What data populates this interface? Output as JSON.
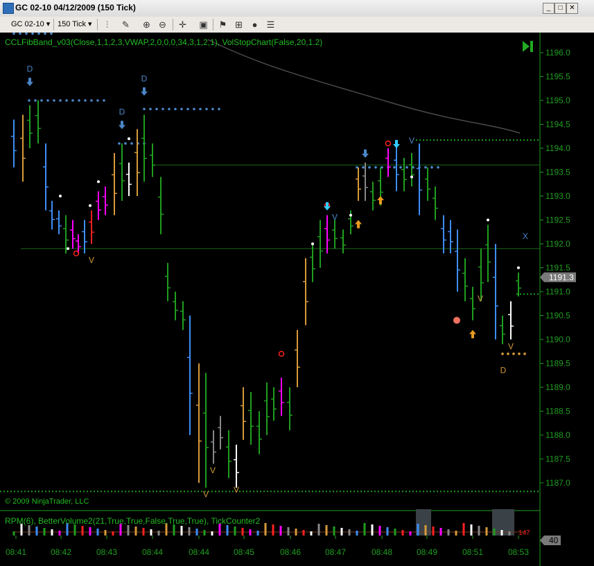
{
  "window": {
    "title": "GC 02-10  04/12/2009 (150 Tick)",
    "minimize": "_",
    "maximize": "□",
    "close": "✕"
  },
  "toolbar": {
    "instrument": "GC 02-10",
    "interval": "150 Tick"
  },
  "indicators": {
    "price_panel": "CCLFibBand_v03(Close,1,1,2,3,VWAP,2,0,0,0,34,3,1,2,1), VolStopChart(False,20,1.2)",
    "volume_panel": "RPM(6),  BetterVolume2(21,True,True,False,True,True),  TickCounter2"
  },
  "copyright": "© 2009 NinjaTrader, LLC",
  "colors": {
    "background": "#000000",
    "axis": "#1f9e1f",
    "up_bar": "#1f9e1f",
    "down_bar": "#3e8ef7",
    "magenta": "#ff00ff",
    "orange": "#d89a3a",
    "text_green": "#22bb22"
  },
  "chart_data": {
    "type": "bar",
    "yaxis": {
      "min": 1187.0,
      "max": 1196.0,
      "ticks": [
        "1196.0",
        "1195.5",
        "1195.0",
        "1194.5",
        "1194.0",
        "1193.5",
        "1193.0",
        "1192.5",
        "1192.0",
        "1191.5",
        "1191.0",
        "1190.5",
        "1190.0",
        "1189.5",
        "1189.0",
        "1188.5",
        "1188.0",
        "1187.5",
        "1187.0"
      ]
    },
    "xaxis": {
      "ticks": [
        "08:41",
        "08:42",
        "08:43",
        "08:44",
        "08:44",
        "08:45",
        "08:46",
        "08:47",
        "08:48",
        "08:49",
        "08:51",
        "08:53"
      ]
    },
    "last_price": "1191.3",
    "volume_label": "40",
    "tick_counter": "147",
    "markers": [
      "D",
      "D",
      "D",
      "V",
      "V",
      "V",
      "V",
      "V",
      "V",
      "V",
      "V",
      "D",
      "X"
    ]
  }
}
